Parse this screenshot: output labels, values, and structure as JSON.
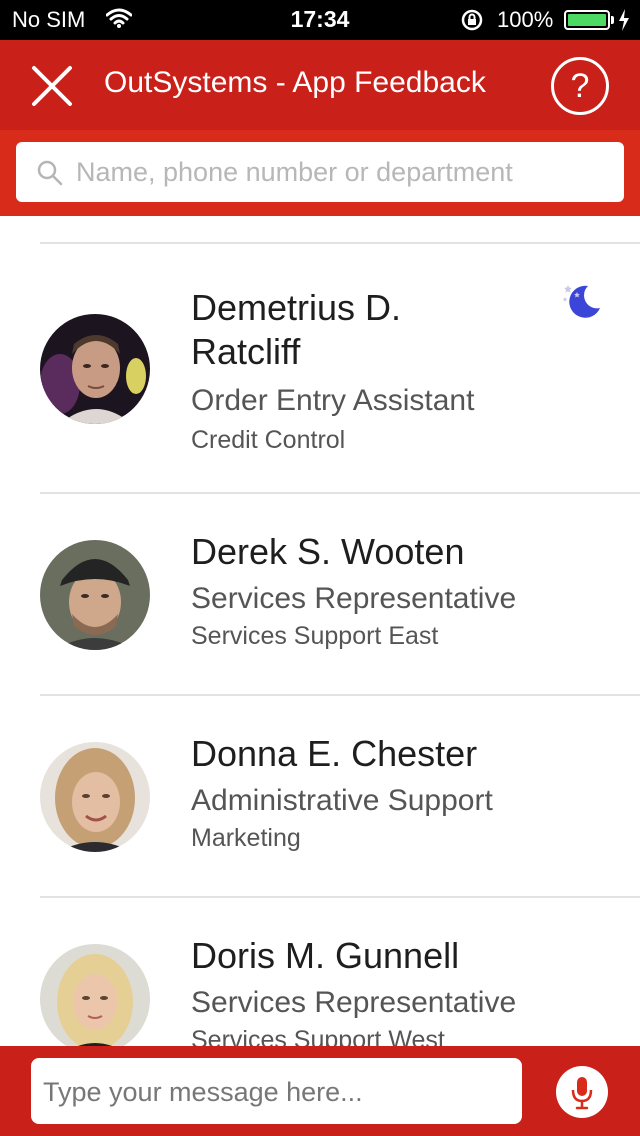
{
  "status_bar": {
    "carrier": "No SIM",
    "time": "17:34",
    "battery_percent": "100%",
    "battery_level": 1.0
  },
  "header": {
    "title": "OutSystems - App Feedback",
    "help_label": "?"
  },
  "search": {
    "placeholder": "Name, phone number or department"
  },
  "contacts": [
    {
      "name": "Demetrius D. Ratcliff",
      "role": "Order Entry Assistant",
      "department": "Credit Control",
      "status_icon": "moon-icon"
    },
    {
      "name": "Derek S. Wooten",
      "role": "Services Representative",
      "department": "Services Support East"
    },
    {
      "name": "Donna E. Chester",
      "role": "Administrative Support",
      "department": "Marketing"
    },
    {
      "name": "Doris M. Gunnell",
      "role": "Services Representative",
      "department": "Services Support West"
    }
  ],
  "message": {
    "placeholder": "Type your message here..."
  },
  "colors": {
    "header_red": "#c9201a",
    "search_band_red": "#d92b1a",
    "moon_blue": "#3b45d8",
    "battery_green": "#4cd964"
  }
}
